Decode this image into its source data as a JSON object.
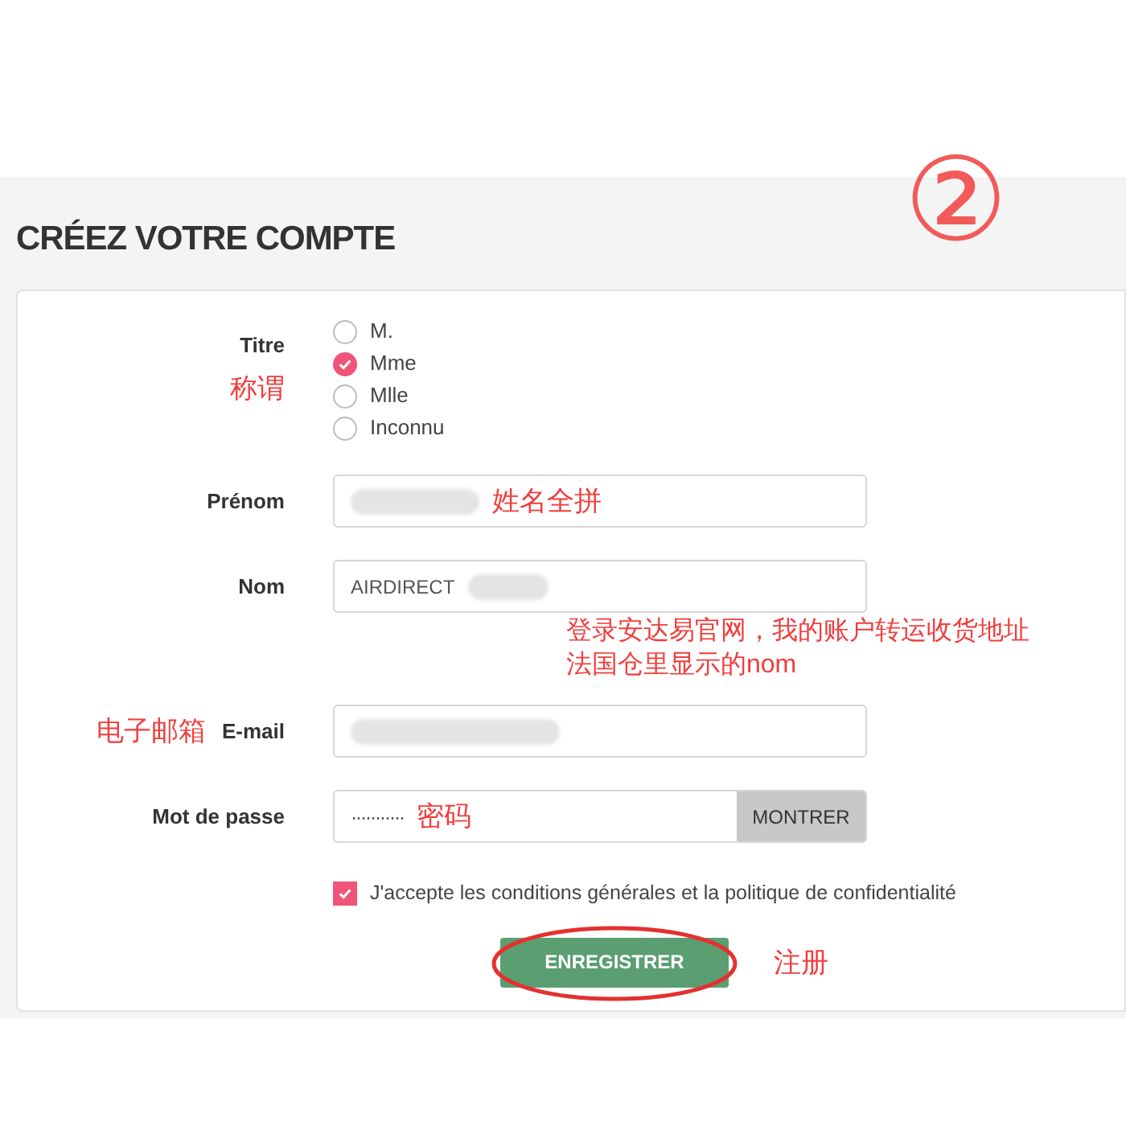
{
  "heading": "CRÉEZ VOTRE COMPTE",
  "badge": "②",
  "title_field": {
    "label": "Titre",
    "label_note": "称谓",
    "options": [
      {
        "label": "M.",
        "selected": false
      },
      {
        "label": "Mme",
        "selected": true
      },
      {
        "label": "Mlle",
        "selected": false
      },
      {
        "label": "Inconnu",
        "selected": false
      }
    ]
  },
  "fields": [
    {
      "kind": "text",
      "label": "Prénom",
      "blurred": true,
      "field_note": "姓名全拼"
    },
    {
      "kind": "text",
      "label": "Nom",
      "value": "AIRDIRECT",
      "blurred": true,
      "side_note": [
        "登录安达易官网，我的账户转运收货地址",
        "法国仓里显示的nom"
      ]
    },
    {
      "kind": "text",
      "label": "E-mail",
      "label_note": "电子邮箱",
      "blurred": true
    },
    {
      "kind": "password",
      "label": "Mot de passe",
      "value": "···········",
      "field_note": "密码",
      "button": "MONTRER"
    }
  ],
  "consent": {
    "text": "J'accepte les conditions générales et la politique de confidentialité",
    "checked": true
  },
  "submit": {
    "label": "ENREGISTRER",
    "circled": true,
    "note": "注册"
  }
}
